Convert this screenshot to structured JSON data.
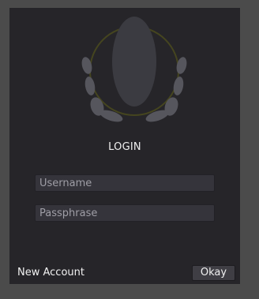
{
  "login": {
    "title": "LOGIN",
    "username_placeholder": "Username",
    "passphrase_placeholder": "Passphrase",
    "new_account_label": "New Account",
    "okay_label": "Okay"
  },
  "logo": {
    "icon": "brain-emblem-icon",
    "ring_color": "#45451f",
    "center_color": "#3b3b41",
    "side_color": "#56565d"
  }
}
